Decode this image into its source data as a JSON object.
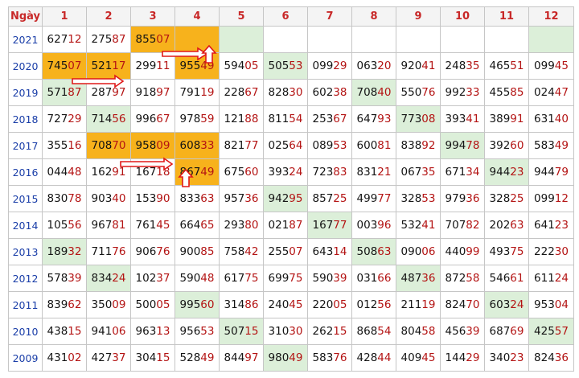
{
  "header": {
    "day_label": "Ngày",
    "months": [
      "1",
      "2",
      "3",
      "4",
      "5",
      "6",
      "7",
      "8",
      "9",
      "10",
      "11",
      "12"
    ]
  },
  "rows": [
    {
      "year": "2021",
      "cells": [
        {
          "h": "627",
          "t": "12",
          "bg": ""
        },
        {
          "h": "275",
          "t": "87",
          "bg": ""
        },
        {
          "h": "855",
          "t": "07",
          "bg": "o"
        },
        {
          "h": "",
          "t": "",
          "bg": "o"
        },
        {
          "h": "",
          "t": "",
          "bg": "g"
        },
        {
          "h": "",
          "t": "",
          "bg": ""
        },
        {
          "h": "",
          "t": "",
          "bg": ""
        },
        {
          "h": "",
          "t": "",
          "bg": ""
        },
        {
          "h": "",
          "t": "",
          "bg": ""
        },
        {
          "h": "",
          "t": "",
          "bg": ""
        },
        {
          "h": "",
          "t": "",
          "bg": ""
        },
        {
          "h": "",
          "t": "",
          "bg": "g"
        }
      ]
    },
    {
      "year": "2020",
      "cells": [
        {
          "h": "745",
          "t": "07",
          "bg": "o"
        },
        {
          "h": "521",
          "t": "17",
          "bg": "o"
        },
        {
          "h": "299",
          "t": "11",
          "bg": ""
        },
        {
          "h": "955",
          "t": "49",
          "bg": "o"
        },
        {
          "h": "594",
          "t": "05",
          "bg": ""
        },
        {
          "h": "505",
          "t": "53",
          "bg": "g"
        },
        {
          "h": "099",
          "t": "29",
          "bg": ""
        },
        {
          "h": "063",
          "t": "20",
          "bg": ""
        },
        {
          "h": "920",
          "t": "41",
          "bg": ""
        },
        {
          "h": "248",
          "t": "35",
          "bg": ""
        },
        {
          "h": "465",
          "t": "51",
          "bg": ""
        },
        {
          "h": "099",
          "t": "45",
          "bg": ""
        }
      ]
    },
    {
      "year": "2019",
      "cells": [
        {
          "h": "571",
          "t": "87",
          "bg": "g"
        },
        {
          "h": "287",
          "t": "97",
          "bg": ""
        },
        {
          "h": "918",
          "t": "97",
          "bg": ""
        },
        {
          "h": "791",
          "t": "19",
          "bg": ""
        },
        {
          "h": "228",
          "t": "67",
          "bg": ""
        },
        {
          "h": "828",
          "t": "30",
          "bg": ""
        },
        {
          "h": "602",
          "t": "38",
          "bg": ""
        },
        {
          "h": "708",
          "t": "40",
          "bg": "g"
        },
        {
          "h": "550",
          "t": "76",
          "bg": ""
        },
        {
          "h": "992",
          "t": "33",
          "bg": ""
        },
        {
          "h": "455",
          "t": "85",
          "bg": ""
        },
        {
          "h": "024",
          "t": "47",
          "bg": ""
        }
      ]
    },
    {
      "year": "2018",
      "cells": [
        {
          "h": "727",
          "t": "29",
          "bg": ""
        },
        {
          "h": "714",
          "t": "56",
          "bg": "g"
        },
        {
          "h": "996",
          "t": "67",
          "bg": ""
        },
        {
          "h": "978",
          "t": "59",
          "bg": ""
        },
        {
          "h": "121",
          "t": "88",
          "bg": ""
        },
        {
          "h": "811",
          "t": "54",
          "bg": ""
        },
        {
          "h": "253",
          "t": "67",
          "bg": ""
        },
        {
          "h": "647",
          "t": "93",
          "bg": ""
        },
        {
          "h": "773",
          "t": "08",
          "bg": "g"
        },
        {
          "h": "393",
          "t": "41",
          "bg": ""
        },
        {
          "h": "389",
          "t": "91",
          "bg": ""
        },
        {
          "h": "631",
          "t": "40",
          "bg": ""
        }
      ]
    },
    {
      "year": "2017",
      "cells": [
        {
          "h": "355",
          "t": "16",
          "bg": ""
        },
        {
          "h": "708",
          "t": "70",
          "bg": "o"
        },
        {
          "h": "958",
          "t": "09",
          "bg": "o"
        },
        {
          "h": "608",
          "t": "33",
          "bg": "o"
        },
        {
          "h": "821",
          "t": "77",
          "bg": ""
        },
        {
          "h": "025",
          "t": "64",
          "bg": ""
        },
        {
          "h": "089",
          "t": "53",
          "bg": ""
        },
        {
          "h": "600",
          "t": "81",
          "bg": ""
        },
        {
          "h": "838",
          "t": "92",
          "bg": ""
        },
        {
          "h": "994",
          "t": "78",
          "bg": "g"
        },
        {
          "h": "392",
          "t": "60",
          "bg": ""
        },
        {
          "h": "583",
          "t": "49",
          "bg": ""
        }
      ]
    },
    {
      "year": "2016",
      "cells": [
        {
          "h": "044",
          "t": "48",
          "bg": ""
        },
        {
          "h": "162",
          "t": "91",
          "bg": ""
        },
        {
          "h": "167",
          "t": "18",
          "bg": ""
        },
        {
          "h": "867",
          "t": "49",
          "bg": "o"
        },
        {
          "h": "675",
          "t": "60",
          "bg": ""
        },
        {
          "h": "393",
          "t": "24",
          "bg": ""
        },
        {
          "h": "723",
          "t": "83",
          "bg": ""
        },
        {
          "h": "831",
          "t": "21",
          "bg": ""
        },
        {
          "h": "067",
          "t": "35",
          "bg": ""
        },
        {
          "h": "671",
          "t": "34",
          "bg": ""
        },
        {
          "h": "944",
          "t": "23",
          "bg": "g"
        },
        {
          "h": "944",
          "t": "79",
          "bg": ""
        }
      ]
    },
    {
      "year": "2015",
      "cells": [
        {
          "h": "830",
          "t": "78",
          "bg": ""
        },
        {
          "h": "903",
          "t": "40",
          "bg": ""
        },
        {
          "h": "153",
          "t": "90",
          "bg": ""
        },
        {
          "h": "833",
          "t": "63",
          "bg": ""
        },
        {
          "h": "957",
          "t": "36",
          "bg": ""
        },
        {
          "h": "942",
          "t": "95",
          "bg": "g"
        },
        {
          "h": "857",
          "t": "25",
          "bg": ""
        },
        {
          "h": "499",
          "t": "77",
          "bg": ""
        },
        {
          "h": "328",
          "t": "53",
          "bg": ""
        },
        {
          "h": "979",
          "t": "36",
          "bg": ""
        },
        {
          "h": "328",
          "t": "25",
          "bg": ""
        },
        {
          "h": "099",
          "t": "12",
          "bg": ""
        }
      ]
    },
    {
      "year": "2014",
      "cells": [
        {
          "h": "105",
          "t": "56",
          "bg": ""
        },
        {
          "h": "967",
          "t": "81",
          "bg": ""
        },
        {
          "h": "761",
          "t": "45",
          "bg": ""
        },
        {
          "h": "664",
          "t": "65",
          "bg": ""
        },
        {
          "h": "293",
          "t": "80",
          "bg": ""
        },
        {
          "h": "021",
          "t": "87",
          "bg": ""
        },
        {
          "h": "167",
          "t": "77",
          "bg": "g"
        },
        {
          "h": "003",
          "t": "96",
          "bg": ""
        },
        {
          "h": "532",
          "t": "41",
          "bg": ""
        },
        {
          "h": "707",
          "t": "82",
          "bg": ""
        },
        {
          "h": "202",
          "t": "63",
          "bg": ""
        },
        {
          "h": "641",
          "t": "23",
          "bg": ""
        }
      ]
    },
    {
      "year": "2013",
      "cells": [
        {
          "h": "189",
          "t": "32",
          "bg": "g"
        },
        {
          "h": "711",
          "t": "76",
          "bg": ""
        },
        {
          "h": "906",
          "t": "76",
          "bg": ""
        },
        {
          "h": "900",
          "t": "85",
          "bg": ""
        },
        {
          "h": "758",
          "t": "42",
          "bg": ""
        },
        {
          "h": "255",
          "t": "07",
          "bg": ""
        },
        {
          "h": "643",
          "t": "14",
          "bg": ""
        },
        {
          "h": "508",
          "t": "63",
          "bg": "g"
        },
        {
          "h": "090",
          "t": "06",
          "bg": ""
        },
        {
          "h": "440",
          "t": "99",
          "bg": ""
        },
        {
          "h": "493",
          "t": "75",
          "bg": ""
        },
        {
          "h": "222",
          "t": "30",
          "bg": ""
        }
      ]
    },
    {
      "year": "2012",
      "cells": [
        {
          "h": "578",
          "t": "39",
          "bg": ""
        },
        {
          "h": "834",
          "t": "24",
          "bg": "g"
        },
        {
          "h": "102",
          "t": "37",
          "bg": ""
        },
        {
          "h": "590",
          "t": "48",
          "bg": ""
        },
        {
          "h": "617",
          "t": "75",
          "bg": ""
        },
        {
          "h": "699",
          "t": "75",
          "bg": ""
        },
        {
          "h": "590",
          "t": "39",
          "bg": ""
        },
        {
          "h": "031",
          "t": "66",
          "bg": ""
        },
        {
          "h": "487",
          "t": "36",
          "bg": "g"
        },
        {
          "h": "872",
          "t": "58",
          "bg": ""
        },
        {
          "h": "546",
          "t": "61",
          "bg": ""
        },
        {
          "h": "611",
          "t": "24",
          "bg": ""
        }
      ]
    },
    {
      "year": "2011",
      "cells": [
        {
          "h": "839",
          "t": "62",
          "bg": ""
        },
        {
          "h": "350",
          "t": "09",
          "bg": ""
        },
        {
          "h": "500",
          "t": "05",
          "bg": ""
        },
        {
          "h": "995",
          "t": "60",
          "bg": "g"
        },
        {
          "h": "314",
          "t": "86",
          "bg": ""
        },
        {
          "h": "240",
          "t": "45",
          "bg": ""
        },
        {
          "h": "220",
          "t": "05",
          "bg": ""
        },
        {
          "h": "012",
          "t": "56",
          "bg": ""
        },
        {
          "h": "211",
          "t": "19",
          "bg": ""
        },
        {
          "h": "824",
          "t": "70",
          "bg": ""
        },
        {
          "h": "603",
          "t": "24",
          "bg": "g"
        },
        {
          "h": "953",
          "t": "04",
          "bg": ""
        }
      ]
    },
    {
      "year": "2010",
      "cells": [
        {
          "h": "438",
          "t": "15",
          "bg": ""
        },
        {
          "h": "941",
          "t": "06",
          "bg": ""
        },
        {
          "h": "963",
          "t": "13",
          "bg": ""
        },
        {
          "h": "956",
          "t": "53",
          "bg": ""
        },
        {
          "h": "507",
          "t": "15",
          "bg": "g"
        },
        {
          "h": "310",
          "t": "30",
          "bg": ""
        },
        {
          "h": "262",
          "t": "15",
          "bg": ""
        },
        {
          "h": "868",
          "t": "54",
          "bg": ""
        },
        {
          "h": "804",
          "t": "58",
          "bg": ""
        },
        {
          "h": "456",
          "t": "39",
          "bg": ""
        },
        {
          "h": "687",
          "t": "69",
          "bg": ""
        },
        {
          "h": "425",
          "t": "57",
          "bg": "g"
        }
      ]
    },
    {
      "year": "2009",
      "cells": [
        {
          "h": "431",
          "t": "02",
          "bg": ""
        },
        {
          "h": "427",
          "t": "37",
          "bg": ""
        },
        {
          "h": "304",
          "t": "15",
          "bg": ""
        },
        {
          "h": "528",
          "t": "49",
          "bg": ""
        },
        {
          "h": "844",
          "t": "97",
          "bg": ""
        },
        {
          "h": "980",
          "t": "49",
          "bg": "g"
        },
        {
          "h": "583",
          "t": "76",
          "bg": ""
        },
        {
          "h": "428",
          "t": "44",
          "bg": ""
        },
        {
          "h": "409",
          "t": "45",
          "bg": ""
        },
        {
          "h": "144",
          "t": "29",
          "bg": ""
        },
        {
          "h": "340",
          "t": "23",
          "bg": ""
        },
        {
          "h": "824",
          "t": "36",
          "bg": ""
        }
      ]
    }
  ],
  "colors": {
    "highlight_orange": "#f7b21c",
    "highlight_green": "#dcefd9",
    "header_text": "#c82828",
    "year_text": "#1a3ea8",
    "tail_digits": "#b41414",
    "arrow": "#e01818"
  }
}
